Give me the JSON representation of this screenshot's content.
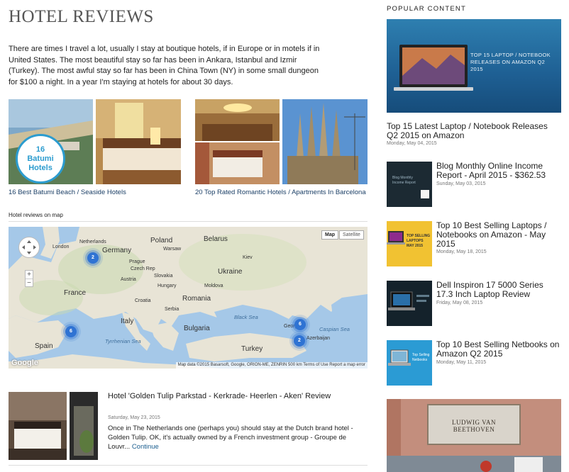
{
  "page": {
    "title": "HOTEL REVIEWS",
    "intro": "There are times I travel a lot, usually I stay at boutique hotels, if in Europe or in motels if in United States. The most beautiful stay so far has been in Ankara, Istanbul and Izmir (Turkey). The most awful stay so far has been in China Town (NY) in some small dungeon for $100 a night. In a year I'm staying at hotels for about 30 days."
  },
  "cards": [
    {
      "title": "16 Best Batumi Beach / Seaside Hotels",
      "badge": "16 Batumi Hotels"
    },
    {
      "title": "20 Top Rated Romantic Hotels / Apartments In Barcelona"
    }
  ],
  "map": {
    "label": "Hotel reviews on map",
    "map_button": "Map",
    "satellite_button": "Satellite",
    "attribution": "Map data ©2015 Basarsoft, Google, ORION-ME, ZENRIN   500 km   Terms of Use   Report a map error",
    "google_logo": "Google",
    "zoom_in": "+",
    "zoom_out": "−",
    "countries": [
      "Poland",
      "Belarus",
      "Germany",
      "Ukraine",
      "France",
      "Romania",
      "Italy",
      "Bulgaria",
      "Spain",
      "Turkey"
    ],
    "cities": [
      "London",
      "Netherlands",
      "Warsaw",
      "Kiev",
      "Prague",
      "Czech Rep",
      "Slovakia",
      "Austria",
      "Hungary",
      "Moldova",
      "Serbia",
      "Croatia",
      "Georgia",
      "Azerbaijan"
    ],
    "seas": [
      "Black Sea",
      "Caspian Sea",
      "Tyrrhenian Sea"
    ],
    "clusters": [
      "2",
      "6",
      "6",
      "2"
    ]
  },
  "article": {
    "title": "Hotel 'Golden Tulip Parkstad - Kerkrade- Heerlen - Aken' Review",
    "date": "Saturday, May 23, 2015",
    "excerpt": "Once in The Netherlands one (perhaps you) should stay at the Dutch brand hotel - Golden Tulip. OK, it's actually owned by a French investment group - Groupe de Louvr...",
    "continue": "Continue"
  },
  "sidebar": {
    "heading": "POPULAR CONTENT",
    "feature": {
      "image_text": "TOP 15 LAPTOP / NOTEBOOK RELEASES ON AMAZON Q2 2015",
      "title": "Top 15 Latest Laptop / Notebook Releases Q2 2015 on Amazon",
      "date": "Monday, May 04, 2015"
    },
    "items": [
      {
        "title": "Blog Monthly Online Income Report - April 2015 - $362.53",
        "date": "Sunday, May 03, 2015",
        "thumb_text": "Blog Monthly Income Report"
      },
      {
        "title": "Top 10 Best Selling Laptops / Notebooks on Amazon - May 2015",
        "date": "Monday, May 18, 2015",
        "thumb_text": "TOP SELLING LAPTOPS MAY 2015"
      },
      {
        "title": "Dell Inspiron 17 5000 Series 17.3 Inch Laptop Review",
        "date": "Friday, May 08, 2015"
      },
      {
        "title": "Top 10 Best Selling Netbooks on Amazon Q2 2015",
        "date": "Monday, May 11, 2015",
        "thumb_text": "Top Selling Netbooks"
      }
    ],
    "bottom_sign": "LUDWIG VAN BEETHOVEN"
  },
  "colors": {
    "link": "#1b3f66",
    "map_water": "#a5c8e8",
    "map_land": "#e8e4d6",
    "cluster": "#2f73d3",
    "feature_bg": "#1e5f93"
  }
}
